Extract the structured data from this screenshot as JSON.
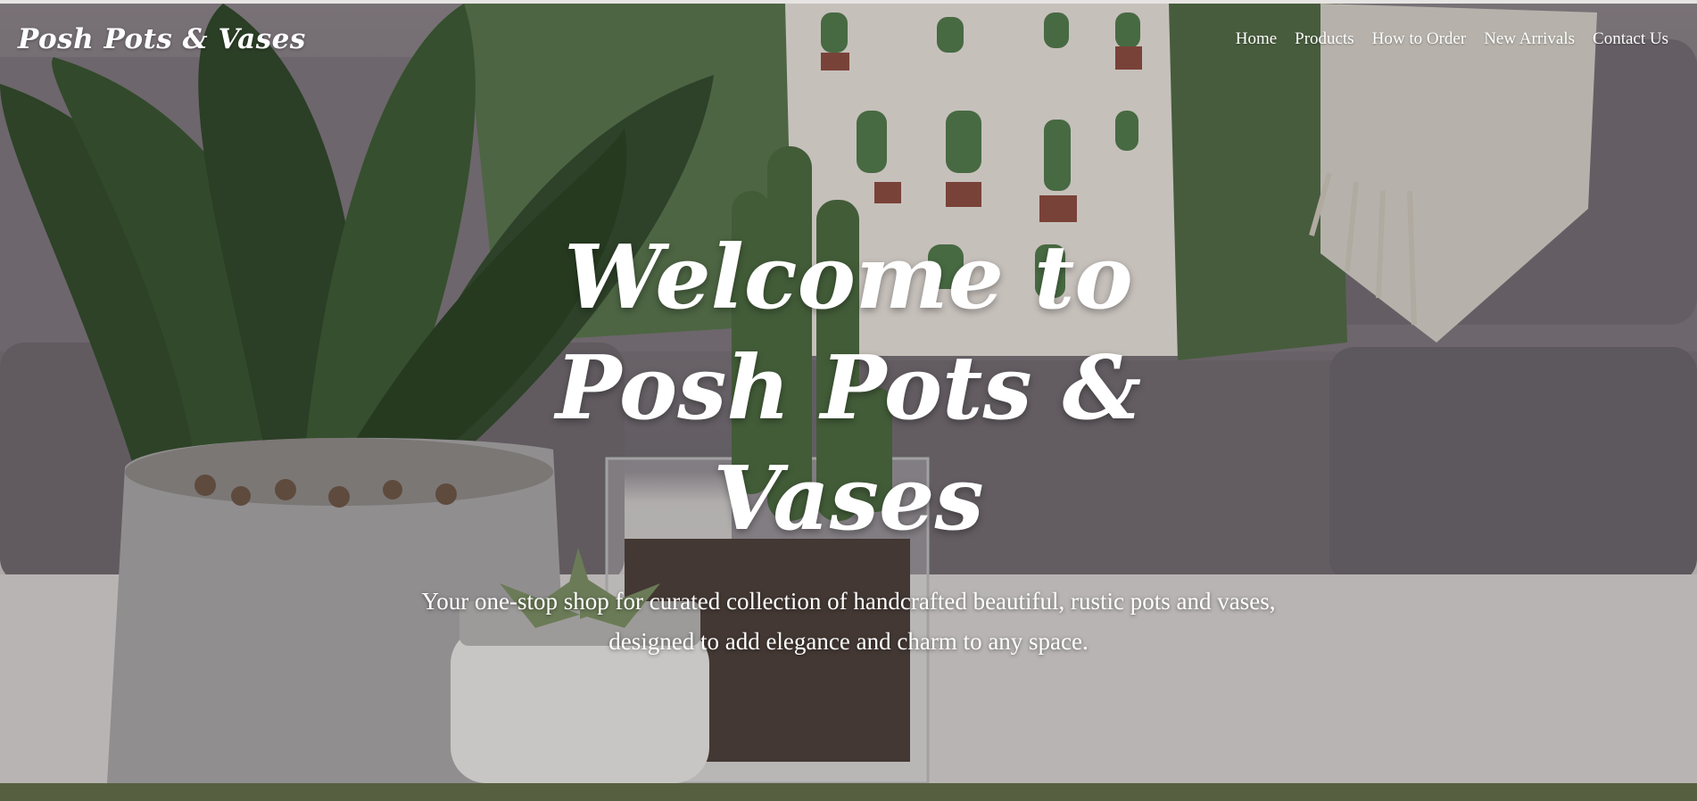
{
  "brand": {
    "name": "Posh Pots & Vases"
  },
  "nav": {
    "items": [
      {
        "label": "Home"
      },
      {
        "label": "Products"
      },
      {
        "label": "How to Order"
      },
      {
        "label": "New Arrivals"
      },
      {
        "label": "Contact Us"
      }
    ]
  },
  "hero": {
    "heading": "Welcome to Posh Pots & Vases",
    "subheading": "Your one-stop shop for curated collection of handcrafted beautiful, rustic pots and vases, designed to add elegance and charm to any space.",
    "background_image_icon": "plants-on-table-photo-icon"
  },
  "colors": {
    "footer_bar": "#566040",
    "text": "#ffffff",
    "plant_green": "#3e5a32",
    "sofa_gray": "#7a7479",
    "table_white": "#d8d4d2"
  }
}
